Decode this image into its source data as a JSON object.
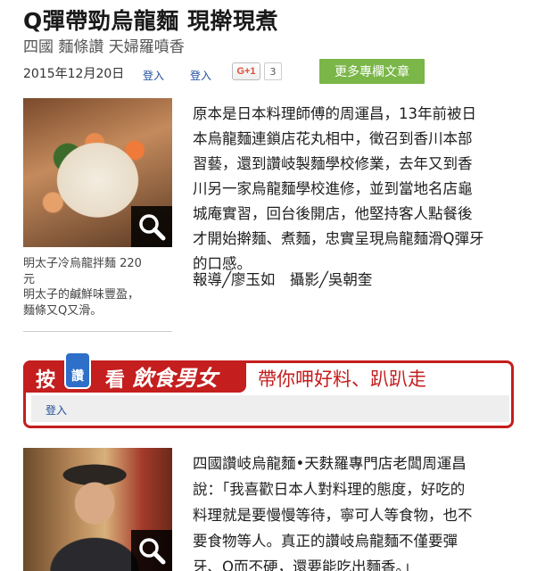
{
  "article": {
    "title": "Q彈帶勁烏龍麵 現擀現煮",
    "subtitle": "四國 麵條讚 天婦羅噴香",
    "date": "2015年12月20日",
    "login_label_1": "登入",
    "login_label_2": "登入",
    "gplus_label": "G+1",
    "gplus_count": "3",
    "more_button": "更多專欄文章"
  },
  "photo1": {
    "caption_lines": [
      "明太子冷烏龍拌麵 220",
      "元",
      "明太子的鹹鮮味豐盈，",
      "麵條又Q又滑。"
    ],
    "icon": "magnifier-icon"
  },
  "body1": {
    "lines": [
      "原本是日本料理師傅的周運昌，13年前被日",
      "本烏龍麵連鎖店花丸相中，徵召到香川本部",
      "習藝，還到讚岐製麵學校修業，去年又到香",
      "川另一家烏龍麵學校進修，並到當地名店龜",
      "城庵實習，回台後開店，他堅持客人點餐後",
      "才開始擀麵、煮麵，忠實呈現烏龍麵滑Q彈牙",
      "的口感。"
    ],
    "byline": "報導╱廖玉如　攝影╱吳朝奎"
  },
  "banner": {
    "an": "按",
    "thumb": "讚",
    "kan": "看",
    "brand": "飲食男女",
    "slogan": "帶你呷好料、趴趴走",
    "login": "登入",
    "colors": {
      "accent": "#c41e1e",
      "thumb": "#2e6fc9"
    }
  },
  "body2": {
    "lines": [
      "四國讚岐烏龍麵•天麩羅專門店老闆周運昌",
      "說：「我喜歡日本人對料理的態度，好吃的",
      "料理就是要慢慢等待，寧可人等食物，也不",
      "要食物等人。真正的讚岐烏龍麵不僅要彈",
      "牙、Q而不硬，還要能吃出麵香。」"
    ]
  },
  "photo2": {
    "icon": "magnifier-icon"
  },
  "colors": {
    "more_button": "#7ab648",
    "link": "#1f4e9c"
  }
}
